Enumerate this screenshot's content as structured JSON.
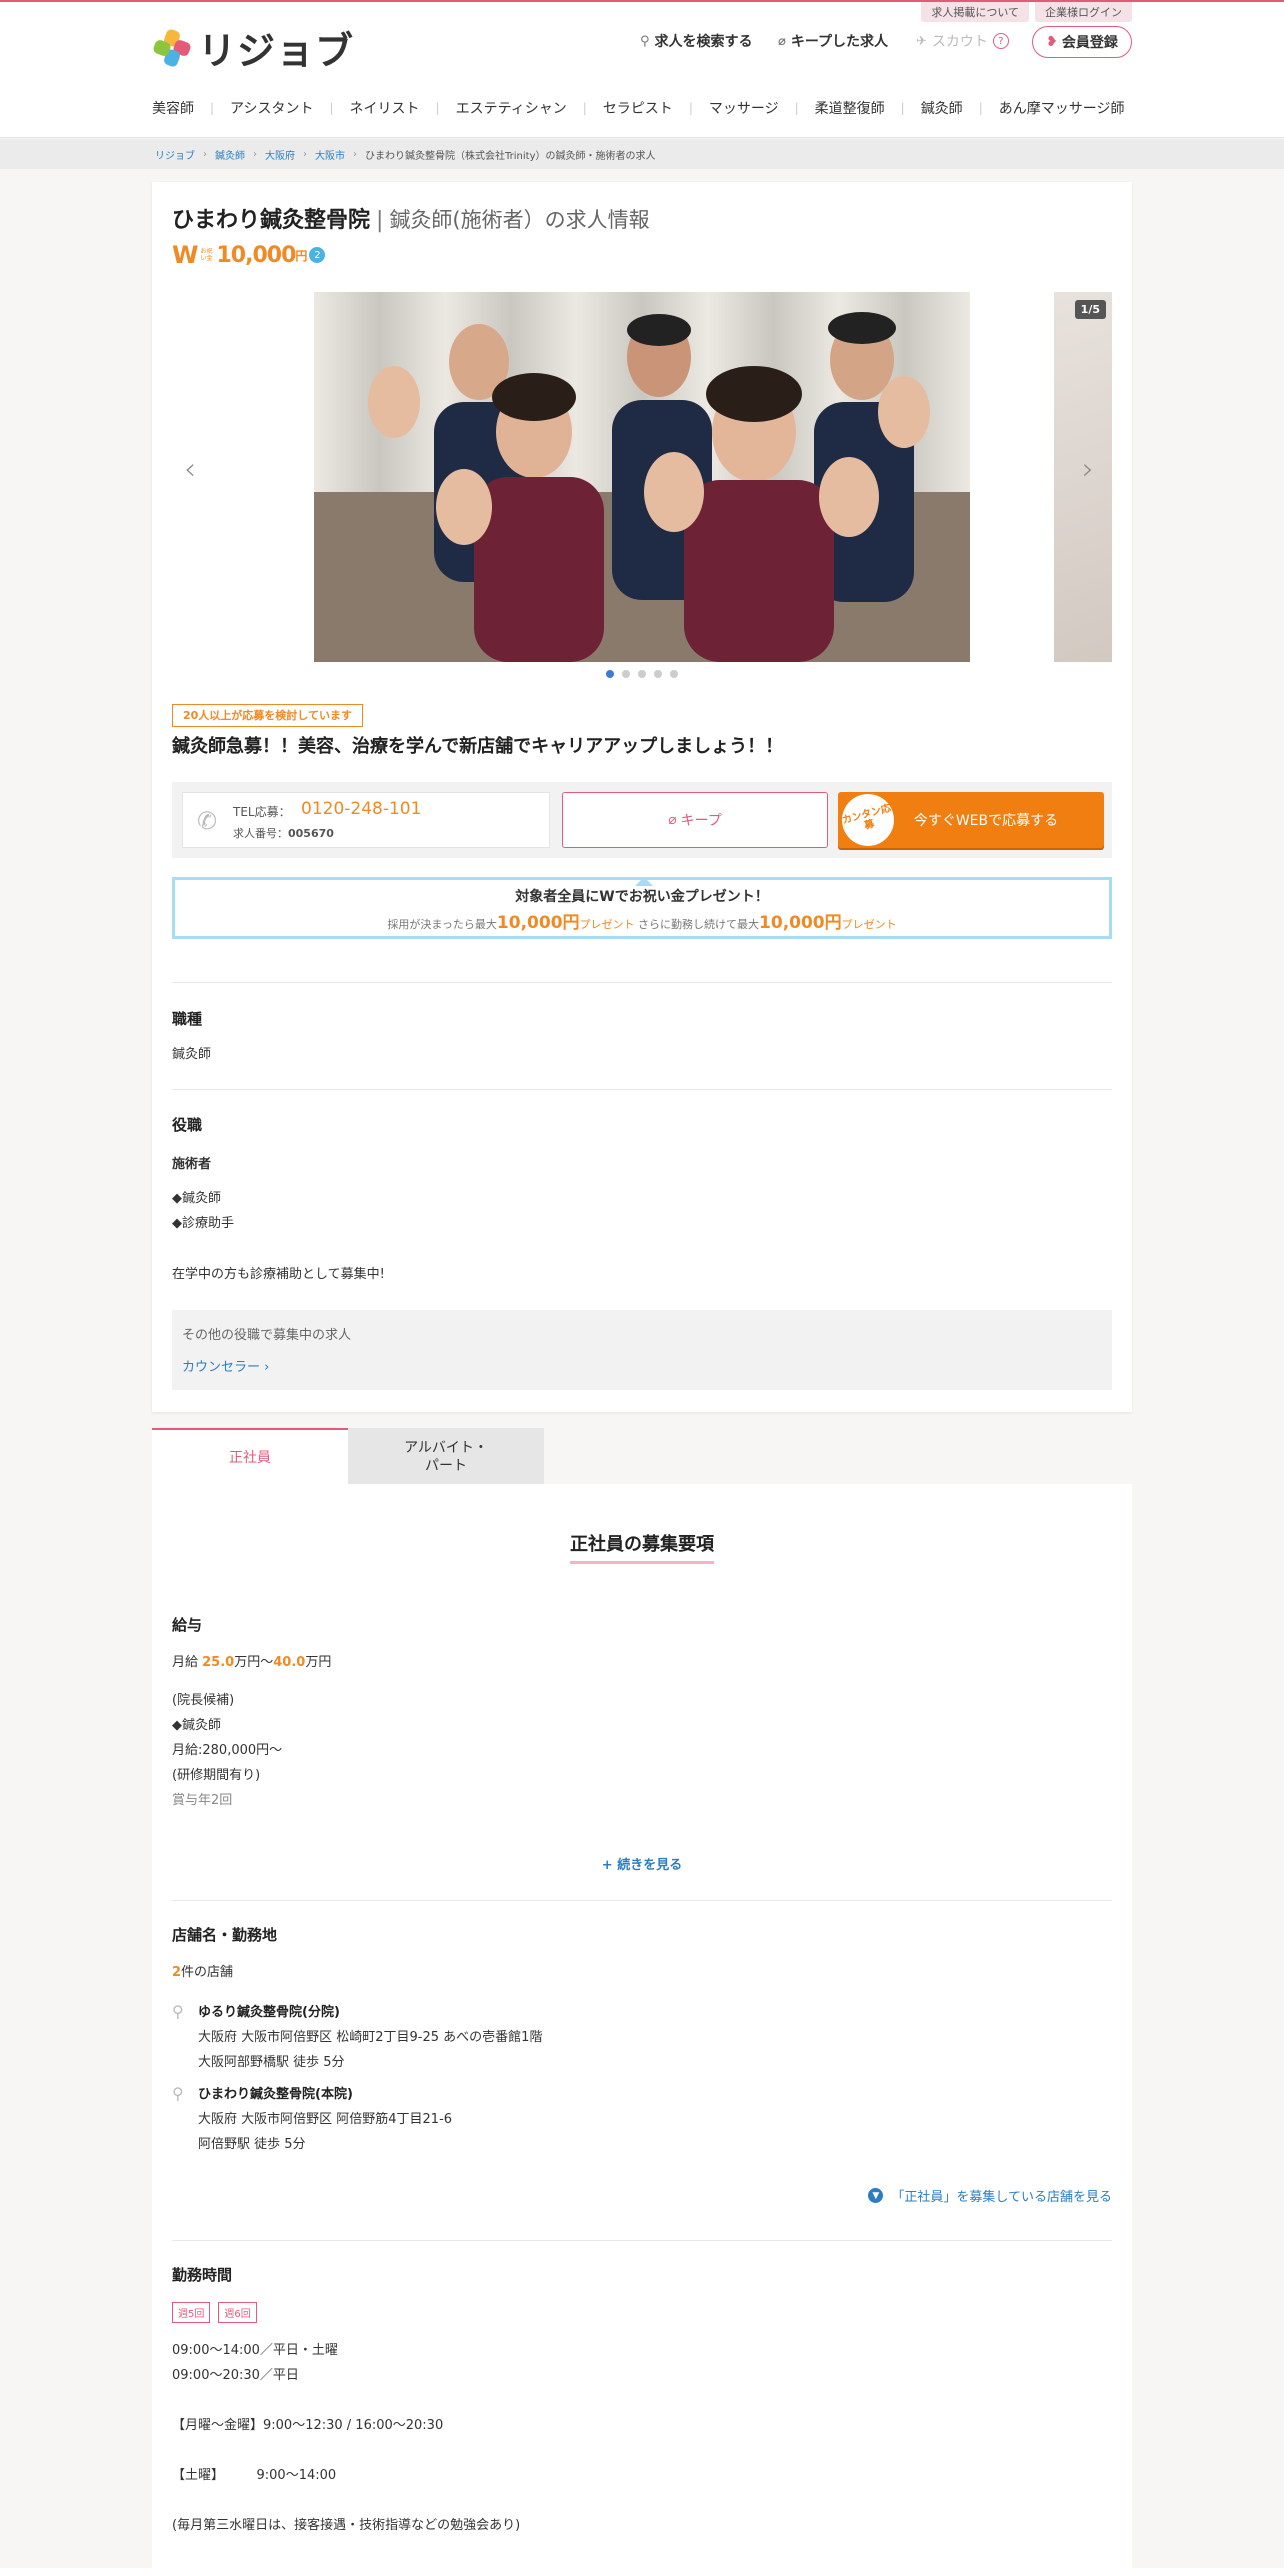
{
  "header": {
    "logo_text": "リジョブ",
    "top_links": [
      "求人掲載について",
      "企業様ログイン"
    ],
    "search_label": "求人を検索する",
    "kept_label": "キープした求人",
    "scout_label": "スカウト",
    "scout_help": "?",
    "register_label": "会員登録",
    "categories": [
      "美容師",
      "アシスタント",
      "ネイリスト",
      "エステティシャン",
      "セラピスト",
      "マッサージ",
      "柔道整復師",
      "鍼灸師",
      "あん摩マッサージ師"
    ]
  },
  "breadcrumbs": [
    "リジョブ",
    "鍼灸師",
    "大阪府",
    "大阪市",
    "ひまわり鍼灸整骨院（株式会社Trinity）の鍼灸師・施術者の求人"
  ],
  "job": {
    "shop_name": "ひまわり鍼灸整骨院",
    "title_suffix": "鍼灸師(施術者）の求人情報",
    "badge_w": "W",
    "badge_small": "お祝い金",
    "badge_amount": "10,000",
    "badge_unit": "円",
    "badge_count": "2",
    "carousel_counter": "1/5",
    "carousel_total": 5,
    "carousel_active": 1,
    "popularity": "20人以上が応募を検討しています",
    "catch_copy": "鍼灸師急募！！美容、治療を学んで新店舗でキャリアアップしましょう！！",
    "tel_label": "TEL応募：",
    "tel_number": "0120-248-101",
    "job_no_label": "求人番号：",
    "job_no": "005670",
    "keep_label": "キープ",
    "apply_seal": "カンタン応募",
    "apply_label": "今すぐWEBで応募する",
    "gift_line1": "対象者全員にWでお祝い金プレゼント！",
    "gift_pre1": "採用が決まったら最大",
    "gift_amt1": "10,000円",
    "gift_post1": "プレゼント",
    "gift_pre2": " さらに勤務し続けて最大",
    "gift_amt2": "10,000円",
    "gift_post2": "プレゼント"
  },
  "sections": {
    "occupation_heading": "職種",
    "occupation": "鍼灸師",
    "role_heading": "役職",
    "role_sub": "施術者",
    "role_item1": "◆鍼灸師",
    "role_item2": "◆診療助手",
    "role_note": "在学中の方も診療補助として募集中!",
    "other_roles_label": "その他の役職で募集中の求人",
    "other_roles_link": "カウンセラー ›"
  },
  "tabs": [
    "正社員",
    "アルバイト・パート"
  ],
  "fulltime": {
    "heading": "正社員の募集要項",
    "salary_heading": "給与",
    "salary_prefix": "月給 ",
    "salary_min": "25.0",
    "salary_mid": "万円〜",
    "salary_max": "40.0",
    "salary_suffix": "万円",
    "salary_lines": [
      "(院長候補)",
      "◆鍼灸師",
      "月給:280,000円〜",
      "(研修期間有り)",
      "賞与年2回"
    ],
    "more_label": "+ 続きを見る",
    "shops_heading": "店舗名・勤務地",
    "shops_count": "2",
    "shops_count_suffix": "件の店舗",
    "shops": [
      {
        "name": "ゆるり鍼灸整骨院(分院)",
        "address": "大阪府 大阪市阿倍野区 松崎町2丁目9-25 あべの壱番館1階",
        "access": "大阪阿部野橋駅 徒歩 5分"
      },
      {
        "name": "ひまわり鍼灸整骨院(本院)",
        "address": "大阪府 大阪市阿倍野区 阿倍野筋4丁目21-6",
        "access": "阿倍野駅 徒歩 5分"
      }
    ],
    "see_shops": "「正社員」を募集している店舗を見る",
    "hours_heading": "勤務時間",
    "hours_badges": [
      "週5回",
      "週6回"
    ],
    "hours_lines": [
      "09:00〜14:00／平日・土曜",
      "09:00〜20:30／平日",
      "",
      "【月曜〜金曜】9:00〜12:30 / 16:00〜20:30",
      "",
      "【土曜】　　　9:00〜14:00",
      "",
      "(毎月第三水曜日は、接客接遇・技術指導などの勉強会あり)"
    ]
  },
  "colors": {
    "brand_pink": "#e45b7a",
    "orange": "#f08a24",
    "link_blue": "#2b7ec1",
    "gift_border": "#a8dcf2"
  }
}
